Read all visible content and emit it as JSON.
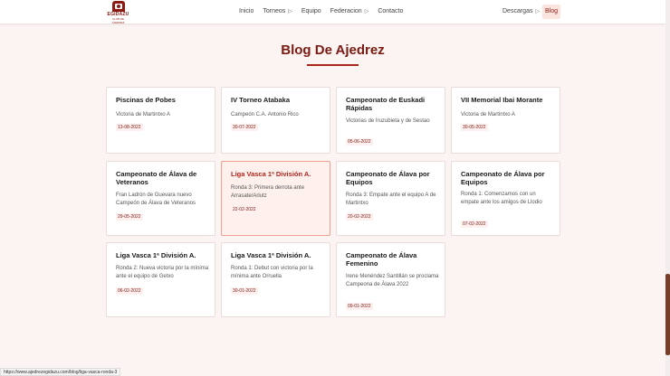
{
  "logo": {
    "text": "EGIDAZU",
    "subtext": "CLUB DE AJEDREZ"
  },
  "nav": {
    "items": [
      {
        "label": "Inicio",
        "dropdown": false
      },
      {
        "label": "Torneos",
        "dropdown": true
      },
      {
        "label": "Equipo",
        "dropdown": false
      },
      {
        "label": "Federacion",
        "dropdown": true
      },
      {
        "label": "Contacto",
        "dropdown": false
      }
    ],
    "descargas": "Descargas",
    "blog": "Blog"
  },
  "page": {
    "title": "Blog De Ajedrez"
  },
  "posts": [
    {
      "title": "Piscinas de Pobes",
      "desc": "Victoria de Martintxo A",
      "date": "13-08-2022"
    },
    {
      "title": "IV Torneo Atabaka",
      "desc": "Campeón C.A. Antonio Rico",
      "date": "30-07-2022"
    },
    {
      "title": "Campeonato de Euskadi Rápidas",
      "desc": "Victorias de Iruzubieta y de Sestao",
      "date": "05-06-2022"
    },
    {
      "title": "VII Memorial Ibai Morante",
      "desc": "Victoria de Martintxo A",
      "date": "30-05-2022"
    },
    {
      "title": "Campeonato de Álava de Veteranos",
      "desc": "Fran Ladrón de Guevara nuevo Campeón de Álava de Veteranos",
      "date": "29-05-2022"
    },
    {
      "title": "Liga Vasca 1ª División A.",
      "desc": "Ronda 3: Primera derrota ante Arrasate/Arlutz",
      "date": "22-02-2022"
    },
    {
      "title": "Campeonato de Álava por Equipos",
      "desc": "Ronda 3: Empate ante el equipo A de Martintxo",
      "date": "20-02-2022"
    },
    {
      "title": "Campeonato de Álava por Equipos",
      "desc": "Ronda 1: Comenzamos con un empate ante los amigos de Llodio",
      "date": "07-02-2022"
    },
    {
      "title": "Liga Vasca 1ª División A.",
      "desc": "Ronda 2: Nueva victoria por la mínima ante el equipo de Getxo",
      "date": "06-02-2022"
    },
    {
      "title": "Liga Vasca 1ª División A.",
      "desc": "Ronda 1: Debut con victoria por la mínima ante Orruella",
      "date": "30-01-2022"
    },
    {
      "title": "Campeonato de Álava Femenino",
      "desc": "Irene Menéndez Santillán se proclama Campeona de Álava 2022",
      "date": "09-01-2022"
    }
  ],
  "status_url": "https://www.ajedrezegidazu.com/blog/liga-vasca-ronda-3",
  "colors": {
    "accent": "#a8231a",
    "title": "#7a1a12",
    "active_bg": "#fdf0ed",
    "active_border": "#f0a090"
  }
}
